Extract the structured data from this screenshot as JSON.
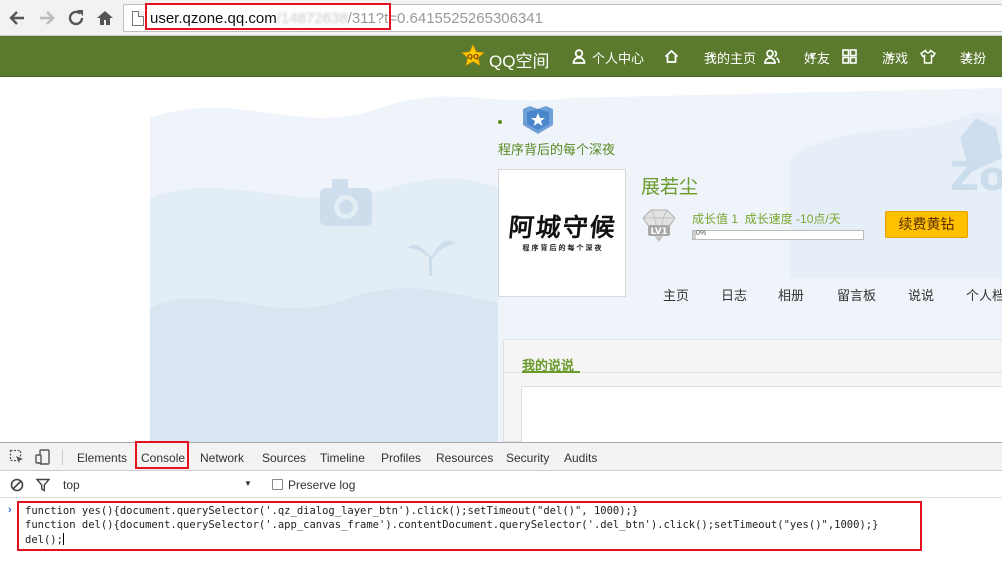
{
  "browser": {
    "url_host": "user.qzone.qq.com",
    "url_path_blurred": "/14872638",
    "url_rest": "/311?t=0.6415525265306341"
  },
  "topnav": {
    "logo_text": "QQ空间",
    "items": [
      {
        "label": "个人中心",
        "icon": "person-icon"
      },
      {
        "label": "我的主页",
        "icon": "home-icon",
        "dropdown": true
      },
      {
        "label": "好友",
        "icon": "friends-icon",
        "dropdown": true
      },
      {
        "label": "游戏",
        "icon": "grid-icon",
        "dropdown": true
      },
      {
        "label": "装扮",
        "icon": "shirt-icon",
        "dropdown": true
      }
    ]
  },
  "profile": {
    "subtitle": "程序背后的每个深夜",
    "avatar_title": "阿城守候",
    "avatar_subtitle": "程序背后的每个深夜",
    "name": "展若尘",
    "level": "LV1",
    "growth": "成长值 1",
    "speed": "成长速度 -10点/天",
    "progress_text": "0%",
    "progress_value": 0.02,
    "vip_button": "续费黄钻",
    "accent_color": "#6a9a2a"
  },
  "tabs": [
    "主页",
    "日志",
    "相册",
    "留言板",
    "说说",
    "个人档"
  ],
  "panel": {
    "title": "我的说说"
  },
  "devtools": {
    "tabs": [
      "Elements",
      "Console",
      "Network",
      "Sources",
      "Timeline",
      "Profiles",
      "Resources",
      "Security",
      "Audits"
    ],
    "active_tab": "Console",
    "context": "top",
    "preserve_log": "Preserve log",
    "prompt": "›",
    "code_lines": [
      "function yes(){document.querySelector('.qz_dialog_layer_btn').click();setTimeout(\"del()\", 1000);}",
      "function del(){document.querySelector('.app_canvas_frame').contentDocument.querySelector('.del_btn').click();setTimeout(\"yes()\",1000);}",
      "del();"
    ],
    "highlight_color": "#e3101e"
  }
}
